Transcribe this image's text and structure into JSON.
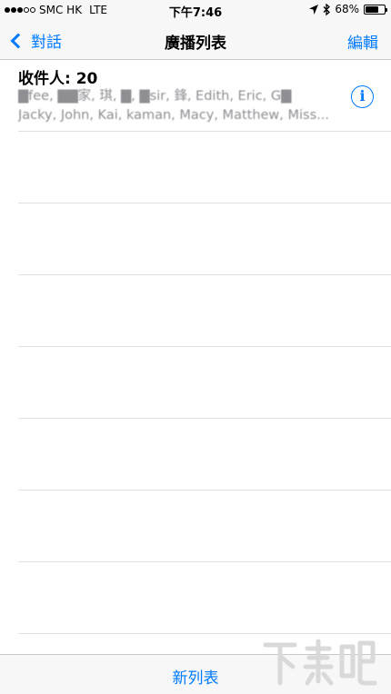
{
  "status_bar": {
    "carrier": "SMC HK",
    "network": "LTE",
    "time": "下午7:46",
    "battery_percent": "68%",
    "battery_level": 0.68
  },
  "nav": {
    "back_label": "對話",
    "title": "廣播列表",
    "edit_label": "編輯"
  },
  "list": {
    "items": [
      {
        "count_label": "收件人: 20",
        "names_line1": "▇fee, ▇▇家, 琪, ▇, ▇sir, 鋒, Edith, Eric, G▇",
        "names_line2": "Jacky, John, Kai, kaman, Macy, Matthew, Miss..."
      }
    ]
  },
  "toolbar": {
    "new_list_label": "新列表"
  },
  "colors": {
    "accent": "#007aff",
    "secondary_text": "#8e8e93",
    "bar_background": "#f7f7f7"
  },
  "icons": {
    "back": "chevron-left-icon",
    "info": "info-circle-icon",
    "location": "location-arrow-icon",
    "bluetooth": "bluetooth-icon",
    "battery": "battery-icon"
  },
  "watermark": "下载吧"
}
